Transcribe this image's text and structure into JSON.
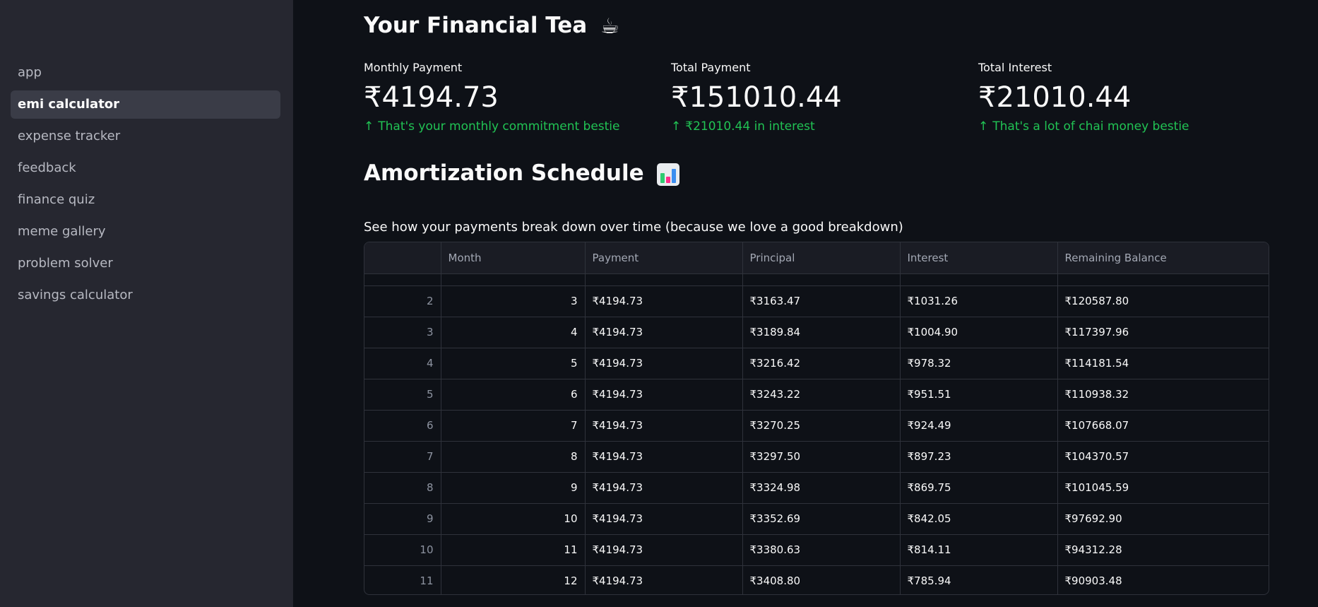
{
  "sidebar": {
    "items": [
      {
        "label": "app",
        "active": false
      },
      {
        "label": "emi calculator",
        "active": true
      },
      {
        "label": "expense tracker",
        "active": false
      },
      {
        "label": "feedback",
        "active": false
      },
      {
        "label": "finance quiz",
        "active": false
      },
      {
        "label": "meme gallery",
        "active": false
      },
      {
        "label": "problem solver",
        "active": false
      },
      {
        "label": "savings calculator",
        "active": false
      }
    ]
  },
  "main": {
    "title": "Your Financial Tea",
    "title_emoji": "☕",
    "metrics": [
      {
        "label": "Monthly Payment",
        "value": "₹4194.73",
        "delta": "That's your monthly commitment bestie"
      },
      {
        "label": "Total Payment",
        "value": "₹151010.44",
        "delta": "₹21010.44 in interest"
      },
      {
        "label": "Total Interest",
        "value": "₹21010.44",
        "delta": "That's a lot of chai money bestie"
      }
    ],
    "delta_arrow": "↑",
    "schedule_title": "Amortization Schedule",
    "schedule_icon": "bar-chart-icon",
    "schedule_subtitle": "See how your payments break down over time (because we love a good breakdown)",
    "colors": {
      "delta": "#21c354",
      "sidebar_bg": "#262730",
      "main_bg": "#0e1117"
    },
    "table": {
      "headers": [
        "",
        "Month",
        "Payment",
        "Principal",
        "Interest",
        "Remaining Balance"
      ],
      "rows": [
        [
          "2",
          "3",
          "₹4194.73",
          "₹3163.47",
          "₹1031.26",
          "₹120587.80"
        ],
        [
          "3",
          "4",
          "₹4194.73",
          "₹3189.84",
          "₹1004.90",
          "₹117397.96"
        ],
        [
          "4",
          "5",
          "₹4194.73",
          "₹3216.42",
          "₹978.32",
          "₹114181.54"
        ],
        [
          "5",
          "6",
          "₹4194.73",
          "₹3243.22",
          "₹951.51",
          "₹110938.32"
        ],
        [
          "6",
          "7",
          "₹4194.73",
          "₹3270.25",
          "₹924.49",
          "₹107668.07"
        ],
        [
          "7",
          "8",
          "₹4194.73",
          "₹3297.50",
          "₹897.23",
          "₹104370.57"
        ],
        [
          "8",
          "9",
          "₹4194.73",
          "₹3324.98",
          "₹869.75",
          "₹101045.59"
        ],
        [
          "9",
          "10",
          "₹4194.73",
          "₹3352.69",
          "₹842.05",
          "₹97692.90"
        ],
        [
          "10",
          "11",
          "₹4194.73",
          "₹3380.63",
          "₹814.11",
          "₹94312.28"
        ],
        [
          "11",
          "12",
          "₹4194.73",
          "₹3408.80",
          "₹785.94",
          "₹90903.48"
        ]
      ]
    }
  }
}
